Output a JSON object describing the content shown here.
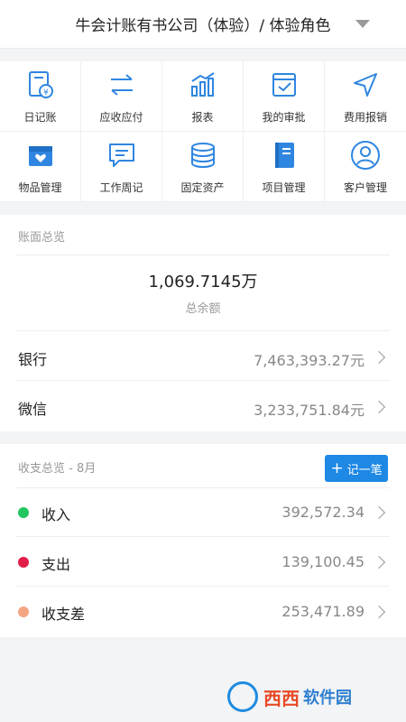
{
  "header": {
    "title": "牛会计账有书公司（体验）/ 体验角色"
  },
  "menu": [
    {
      "label": "日记账",
      "icon": "journal-icon"
    },
    {
      "label": "应收应付",
      "icon": "transfer-arrows-icon"
    },
    {
      "label": "报表",
      "icon": "bar-chart-icon"
    },
    {
      "label": "我的审批",
      "icon": "approval-icon"
    },
    {
      "label": "费用报销",
      "icon": "navigation-icon"
    },
    {
      "label": "物品管理",
      "icon": "box-icon"
    },
    {
      "label": "工作周记",
      "icon": "chat-note-icon"
    },
    {
      "label": "固定资产",
      "icon": "coins-stack-icon"
    },
    {
      "label": "项目管理",
      "icon": "notebook-icon"
    },
    {
      "label": "客户管理",
      "icon": "user-icon"
    }
  ],
  "overview": {
    "title": "账面总览",
    "total_value": "1,069.7145万",
    "total_label": "总余额",
    "rows": [
      {
        "label": "银行",
        "value": "7,463,393.27元"
      },
      {
        "label": "微信",
        "value": "3,233,751.84元"
      }
    ]
  },
  "income": {
    "title": "收支总览 - 8月",
    "button_label": "记一笔",
    "rows": [
      {
        "label": "收入",
        "value": "392,572.34",
        "color": "#22c55e"
      },
      {
        "label": "支出",
        "value": "139,100.45",
        "color": "#e11d48"
      },
      {
        "label": "收支差",
        "value": "253,471.89",
        "color": "#f4a582"
      }
    ]
  },
  "watermark": {
    "text": "西西",
    "subtext": "软件园"
  }
}
